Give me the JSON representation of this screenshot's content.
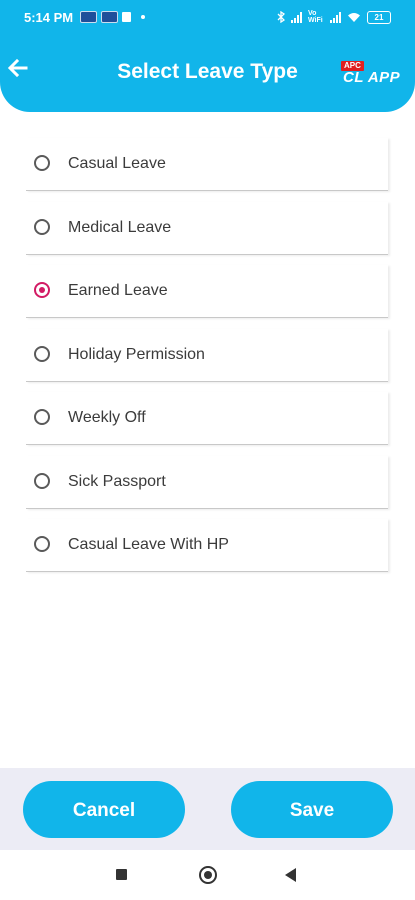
{
  "status_bar": {
    "time": "5:14 PM",
    "network_label": "Vo WiFi",
    "battery": "21"
  },
  "header": {
    "title": "Select Leave Type",
    "logo_top": "APC",
    "logo_main": "CL APP",
    "back_icon": "arrow-left-icon"
  },
  "options": [
    {
      "label": "Casual Leave",
      "checked": false
    },
    {
      "label": "Medical Leave",
      "checked": false
    },
    {
      "label": "Earned Leave",
      "checked": true
    },
    {
      "label": "Holiday Permission",
      "checked": false
    },
    {
      "label": "Weekly Off",
      "checked": false
    },
    {
      "label": "Sick Passport",
      "checked": false
    },
    {
      "label": "Casual Leave With HP",
      "checked": false
    }
  ],
  "actions": {
    "cancel_label": "Cancel",
    "save_label": "Save"
  },
  "colors": {
    "primary": "#11b5ea",
    "radio_checked": "#d21b64",
    "bottom_bar": "#ececf5"
  }
}
